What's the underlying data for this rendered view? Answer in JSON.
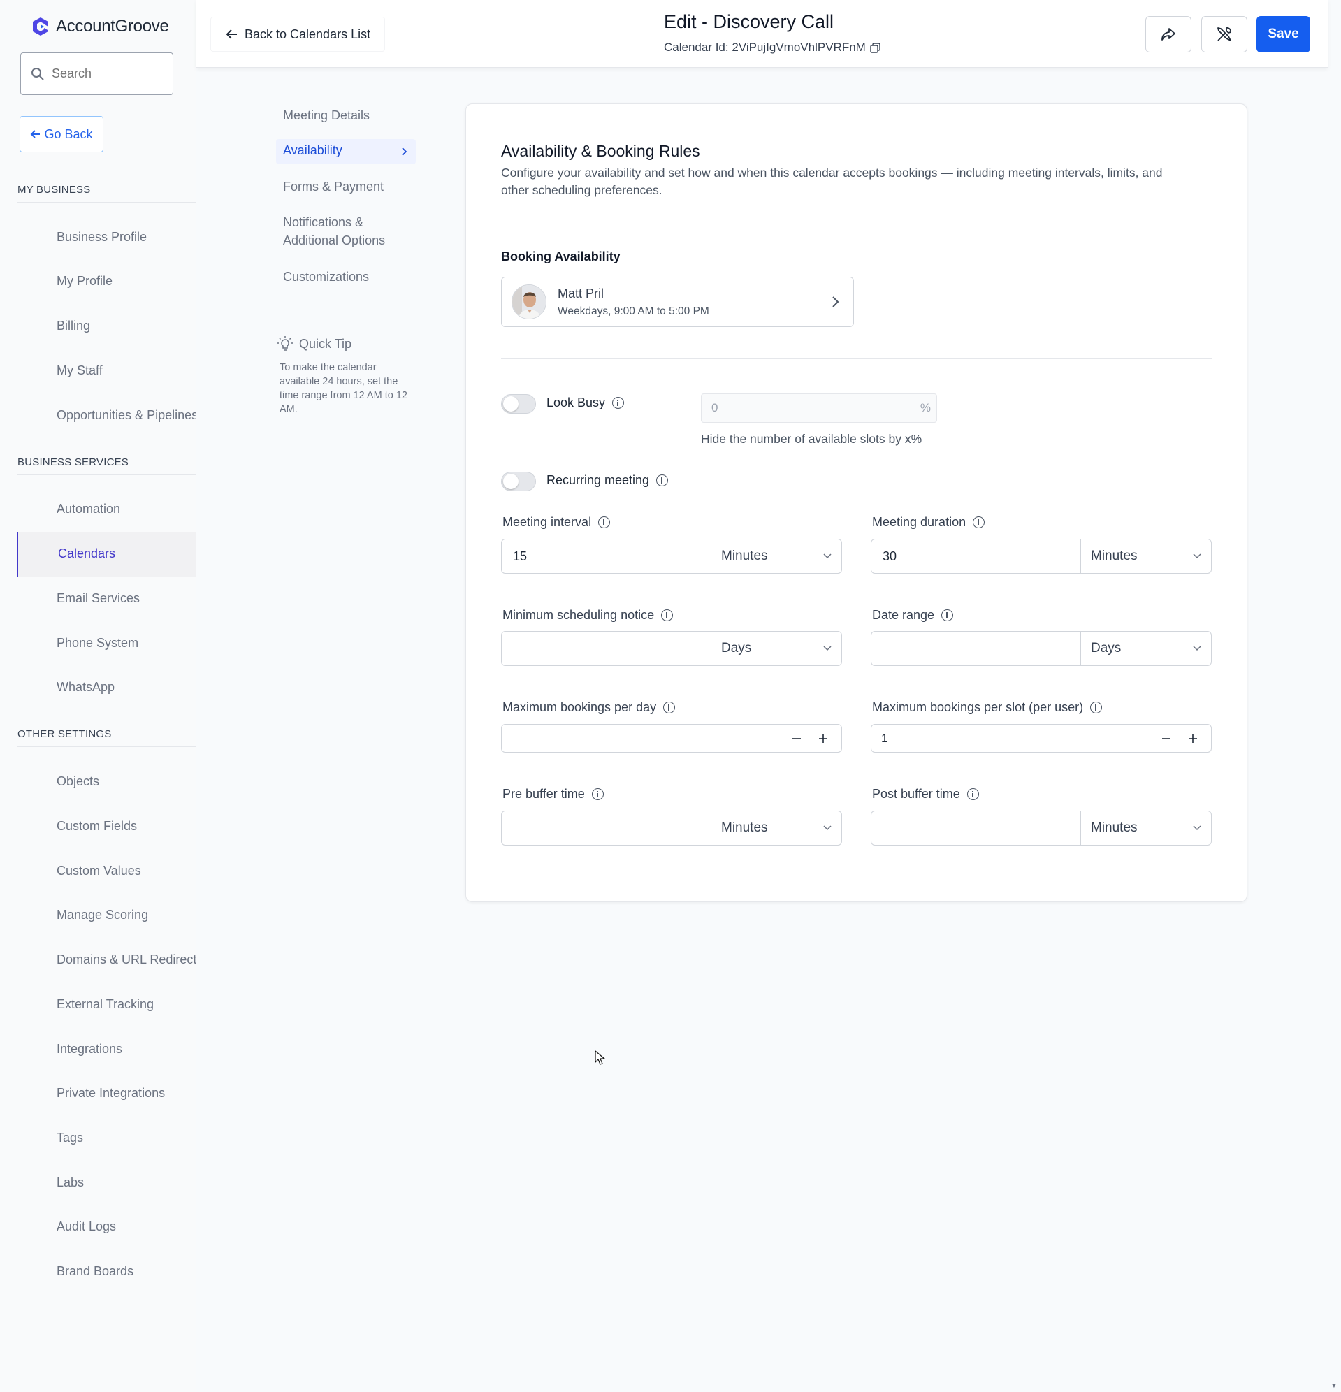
{
  "brand": {
    "name": "AccountGroove"
  },
  "sidebar": {
    "search_placeholder": "Search",
    "go_back": "Go Back",
    "sections": [
      {
        "title": "MY BUSINESS",
        "items": [
          "Business Profile",
          "My Profile",
          "Billing",
          "My Staff",
          "Opportunities & Pipelines"
        ]
      },
      {
        "title": "BUSINESS SERVICES",
        "items": [
          "Automation",
          "Calendars",
          "Email Services",
          "Phone System",
          "WhatsApp"
        ]
      },
      {
        "title": "OTHER SETTINGS",
        "items": [
          "Objects",
          "Custom Fields",
          "Custom Values",
          "Manage Scoring",
          "Domains & URL Redirects",
          "External Tracking",
          "Integrations",
          "Private Integrations",
          "Tags",
          "Labs",
          "Audit Logs",
          "Brand Boards"
        ]
      }
    ],
    "active_item": "Calendars"
  },
  "header": {
    "back_label": "Back to Calendars List",
    "title": "Edit - Discovery Call",
    "calendar_id": "Calendar Id: 2ViPujIgVmoVhlPVRFnM",
    "save_label": "Save"
  },
  "subnav": {
    "items": [
      "Meeting Details",
      "Availability",
      "Forms & Payment",
      "Notifications &",
      "Additional Options",
      "Customizations"
    ],
    "active": "Availability",
    "tip_title": "Quick Tip",
    "tip_text": "To make the calendar available 24 hours, set the time range from 12 AM to 12 AM."
  },
  "card": {
    "title": "Availability & Booking Rules",
    "description": "Configure your availability and set how and when this calendar accepts bookings — including meeting intervals, limits, and other scheduling preferences.",
    "booking_availability": {
      "label": "Booking Availability",
      "user_name": "Matt Pril",
      "hours": "Weekdays, 9:00 AM to 5:00 PM"
    },
    "look_busy": {
      "label": "Look Busy",
      "enabled": false,
      "value": "0",
      "suffix": "%",
      "help": "Hide the number of available slots by x%"
    },
    "recurring": {
      "label": "Recurring meeting",
      "enabled": false
    },
    "meeting_interval": {
      "label": "Meeting interval",
      "value": "15",
      "unit": "Minutes"
    },
    "meeting_duration": {
      "label": "Meeting duration",
      "value": "30",
      "unit": "Minutes"
    },
    "min_notice": {
      "label": "Minimum scheduling notice",
      "value": "",
      "unit": "Days"
    },
    "date_range": {
      "label": "Date range",
      "value": "",
      "unit": "Days"
    },
    "max_per_day": {
      "label": "Maximum bookings per day",
      "value": ""
    },
    "max_per_slot": {
      "label": "Maximum bookings per slot (per user)",
      "value": "1"
    },
    "pre_buffer": {
      "label": "Pre buffer time",
      "value": "",
      "unit": "Minutes"
    },
    "post_buffer": {
      "label": "Post buffer time",
      "value": "",
      "unit": "Minutes"
    }
  },
  "colors": {
    "primary": "#155eef",
    "active_nav": "#4338ca",
    "link": "#2563eb"
  }
}
